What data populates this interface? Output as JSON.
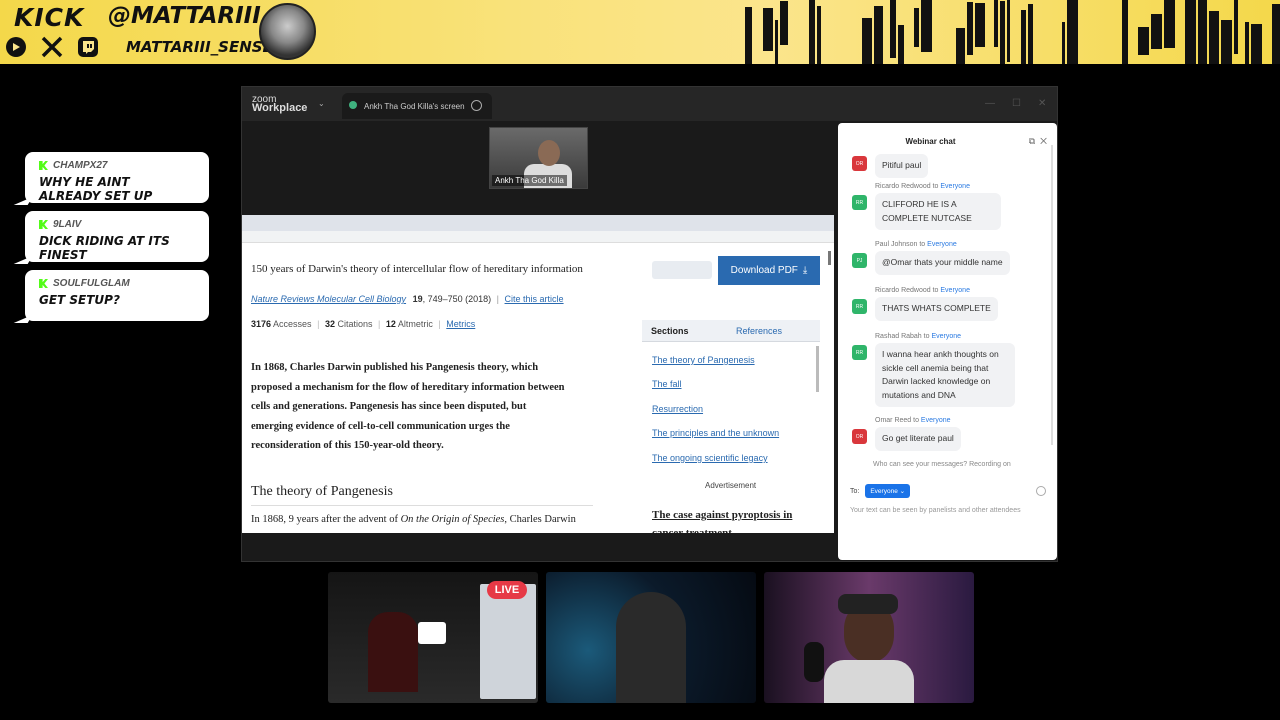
{
  "banner": {
    "brand": "KICK",
    "handle": "@MATTARIII",
    "sub_handle": "MATTARIII_SENSEI",
    "socials": [
      "youtube-icon",
      "x-icon",
      "twitch-icon"
    ],
    "colors": {
      "background": "#f9e27a",
      "text": "#111111"
    }
  },
  "overlay_chat": [
    {
      "user": "CHAMPX27",
      "message": "WHY HE AINT ALREADY SET UP"
    },
    {
      "user": "9LAIV",
      "message": "DICK RIDING AT ITS FINEST"
    },
    {
      "user": "SOULFULGLAM",
      "message": "GET SETUP?"
    }
  ],
  "zoom": {
    "brand_line1": "zoom",
    "brand_line2": "Workplace",
    "tab_label": "Ankh Tha God Killa's screen",
    "speaker_name": "Ankh Tha God Killa"
  },
  "article": {
    "title": "150 years of Darwin's theory of intercellular flow of hereditary information",
    "download_label": "Download PDF",
    "journal": "Nature Reviews Molecular Cell Biology",
    "volume": "19",
    "pages_year": ", 749–750 (2018)",
    "cite": "Cite this article",
    "accesses_count": "3176",
    "accesses_label": "Accesses",
    "citations_count": "32",
    "citations_label": "Citations",
    "altmetric_count": "12",
    "altmetric_label": "Altmetric",
    "metrics_link": "Metrics",
    "abstract_lines": [
      "In 1868, Charles Darwin published his Pangenesis theory, which",
      "proposed a mechanism for the flow of hereditary information between",
      "cells and generations. Pangenesis has since been disputed, but",
      "emerging evidence of cell-to-cell communication urges the",
      "reconsideration of this 150-year-old theory."
    ],
    "section_heading": "The theory of Pangenesis",
    "para_start": "In 1868, 9 years after the advent of ",
    "para_italic": "On the Origin of Species",
    "para_end": ", Charles Darwin",
    "sidebar_tabs": [
      "Sections",
      "References"
    ],
    "sections": [
      "The theory of Pangenesis",
      "The fall",
      "Resurrection",
      "The principles and the unknown",
      "The ongoing scientific legacy"
    ],
    "ad_label": "Advertisement",
    "ad_title": "The case against pyroptosis in cancer treatment"
  },
  "webinar_chat": {
    "title": "Webinar chat",
    "messages": [
      {
        "sender": "",
        "to": "",
        "initials": "OR",
        "color": "#d9373c",
        "text": "Pitiful paul"
      },
      {
        "sender": "Ricardo Redwood",
        "to": "Everyone",
        "initials": "RR",
        "color": "#2fb56a",
        "text": "CLIFFORD HE IS A COMPLETE NUTCASE"
      },
      {
        "sender": "Paul Johnson",
        "to": "Everyone",
        "initials": "PJ",
        "color": "#2fb56a",
        "text": "@Omar thats your middle name"
      },
      {
        "sender": "Ricardo Redwood",
        "to": "Everyone",
        "initials": "RR",
        "color": "#2fb56a",
        "text": "THATS WHATS COMPLETE"
      },
      {
        "sender": "Rashad Rabah",
        "to": "Everyone",
        "initials": "RR",
        "color": "#2fb56a",
        "text": "I wanna hear ankh thoughts on sickle cell anemia being that Darwin lacked knowledge on mutations and DNA"
      },
      {
        "sender": "Omar Reed",
        "to": "Everyone",
        "initials": "OR",
        "color": "#d9373c",
        "text": "Go get literate paul"
      }
    ],
    "to_word": " to ",
    "who_can_see": "Who can see your messages? Recording on",
    "to_label": "To:",
    "to_value": "Everyone",
    "placeholder": "Your text can be seen by panelists and other attendees"
  },
  "cams": {
    "live_label": "LIVE"
  }
}
